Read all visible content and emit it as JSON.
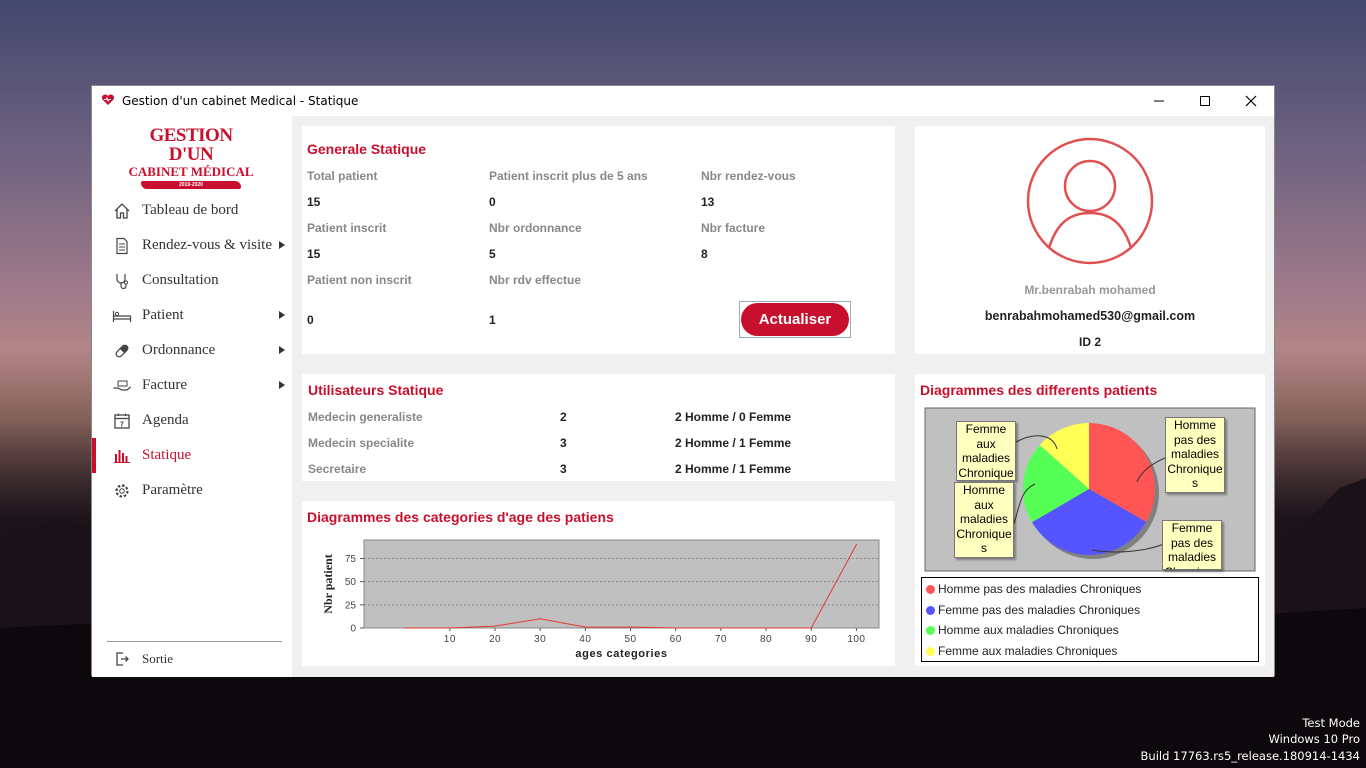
{
  "window": {
    "title": "Gestion d'un cabinet Medical - Statique",
    "controls": {
      "minimize": "—",
      "maximize": "☐",
      "close": "✕"
    }
  },
  "logo": {
    "line1": "GESTION D'UN",
    "line2": "CABINET MÉDICAL",
    "years": "2019-2020"
  },
  "sidebar": {
    "items": [
      {
        "label": "Tableau de bord",
        "icon": "home-icon",
        "submenu": false
      },
      {
        "label": "Rendez-vous & visite",
        "icon": "document-icon",
        "submenu": true
      },
      {
        "label": "Consultation",
        "icon": "stethoscope-icon",
        "submenu": false
      },
      {
        "label": "Patient",
        "icon": "bed-icon",
        "submenu": true
      },
      {
        "label": "Ordonnance",
        "icon": "pill-icon",
        "submenu": true
      },
      {
        "label": "Facture",
        "icon": "payment-icon",
        "submenu": true
      },
      {
        "label": "Agenda",
        "icon": "calendar-icon",
        "submenu": false
      },
      {
        "label": "Statique",
        "icon": "bar-chart-icon",
        "submenu": false,
        "active": true
      },
      {
        "label": "Paramètre",
        "icon": "gear-icon",
        "submenu": false
      }
    ],
    "logout": "Sortie"
  },
  "general": {
    "title": "Generale Statique",
    "total_patient_label": "Total patient",
    "total_patient": "15",
    "plus5_label": "Patient inscrit plus de 5 ans",
    "plus5": "0",
    "rdv_label": "Nbr rendez-vous",
    "rdv": "13",
    "inscrit_label": "Patient inscrit",
    "inscrit": "15",
    "ordonnance_label": "Nbr ordonnance",
    "ordonnance": "5",
    "facture_label": "Nbr facture",
    "facture": "8",
    "non_inscrit_label": "Patient non inscrit",
    "non_inscrit": "0",
    "rdv_effectue_label": "Nbr rdv effectue",
    "rdv_effectue": "1",
    "refresh_button": "Actualiser"
  },
  "profile": {
    "name": "Mr.benrabah mohamed",
    "email": "benrabahmohamed530@gmail.com",
    "id": "ID 2"
  },
  "users": {
    "title": "Utilisateurs Statique",
    "rows": [
      {
        "role": "Medecin generaliste",
        "count": "2",
        "split": "2 Homme / 0 Femme"
      },
      {
        "role": "Medecin specialite",
        "count": "3",
        "split": "2 Homme / 1 Femme"
      },
      {
        "role": "Secretaire",
        "count": "3",
        "split": "2 Homme / 1 Femme"
      }
    ]
  },
  "pie_panel": {
    "title": "Diagrammes des differents patients",
    "callouts": {
      "femme_aux": "Femme aux maladies Chronique",
      "homme_aux": "Homme aux maladies Chronique s",
      "homme_pas": "Homme pas des maladies Chronique s",
      "femme_pas": "Femme pas des maladies Chronique"
    }
  },
  "age_panel": {
    "title": "Diagrammes des categories d'age des patiens"
  },
  "chart_data": [
    {
      "type": "line",
      "title": "",
      "xlabel": "ages categories",
      "ylabel": "Nbr patient",
      "x": [
        0,
        10,
        20,
        30,
        40,
        50,
        60,
        70,
        80,
        90,
        100
      ],
      "x_ticks": [
        "10",
        "20",
        "30",
        "40",
        "50",
        "60",
        "70",
        "80",
        "90",
        "100"
      ],
      "y_ticks": [
        "0",
        "25",
        "50",
        "75"
      ],
      "series": [
        {
          "values": [
            0,
            0,
            2,
            10,
            1,
            1,
            0,
            0,
            0,
            0,
            90
          ],
          "color": "#e53935"
        }
      ],
      "xlim": [
        -9,
        105
      ],
      "ylim": [
        0,
        95
      ],
      "grid": true
    },
    {
      "type": "pie",
      "slices": [
        {
          "label": "Homme pas des maladies Chroniques",
          "value": 33.3,
          "color": "#ff5555"
        },
        {
          "label": "Femme pas des maladies Chroniques",
          "value": 33.3,
          "color": "#5555ff"
        },
        {
          "label": "Homme aux maladies Chroniques",
          "value": 20.0,
          "color": "#55ff55"
        },
        {
          "label": "Femme aux maladies Chroniques",
          "value": 13.4,
          "color": "#ffff55"
        }
      ],
      "legend_position": "bottom"
    }
  ],
  "os_watermark": {
    "line1": "Test Mode",
    "line2": "Windows 10 Pro",
    "line3": "Build 17763.rs5_release.180914-1434"
  }
}
